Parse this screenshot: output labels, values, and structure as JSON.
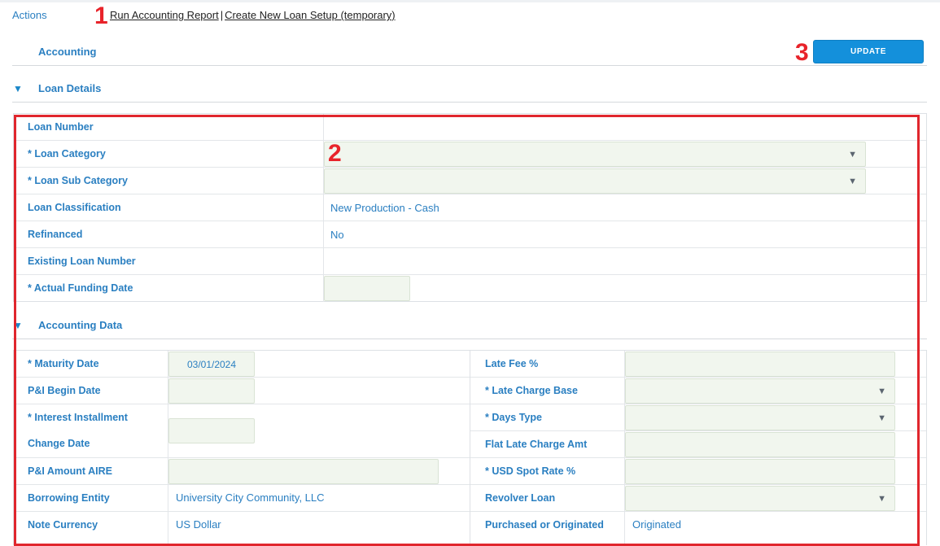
{
  "header": {
    "actions_label": "Actions",
    "links": [
      "Run Accounting Report",
      "Create New Loan Setup (temporary)"
    ],
    "separator": "|"
  },
  "markers": [
    "1",
    "2",
    "3"
  ],
  "accounting": {
    "title": "Accounting",
    "update_label": "UPDATE"
  },
  "loan_details": {
    "title": "Loan Details",
    "rows": [
      {
        "label": "Loan Number",
        "value": ""
      },
      {
        "label": "* Loan Category",
        "value": ""
      },
      {
        "label": "* Loan Sub Category",
        "value": ""
      },
      {
        "label": "Loan Classification",
        "value": "New Production - Cash"
      },
      {
        "label": "Refinanced",
        "value": "No"
      },
      {
        "label": "Existing Loan Number",
        "value": ""
      },
      {
        "label": "* Actual Funding Date",
        "value": ""
      }
    ]
  },
  "accounting_data": {
    "title": "Accounting Data",
    "left": [
      {
        "label": "* Maturity Date",
        "value": "03/01/2024"
      },
      {
        "label": "P&I Begin Date",
        "value": ""
      },
      {
        "label": "* Interest Installment",
        "label2": "Change Date",
        "value": ""
      },
      {
        "label": "P&I Amount AIRE",
        "value": ""
      },
      {
        "label": "Borrowing Entity",
        "value": "University City Community, LLC"
      },
      {
        "label": "Note Currency",
        "value": "US Dollar"
      }
    ],
    "right": [
      {
        "label": "Late Fee %",
        "value": ""
      },
      {
        "label": "* Late Charge Base",
        "value": ""
      },
      {
        "label": "* Days Type",
        "value": ""
      },
      {
        "label": "Flat Late Charge Amt",
        "value": ""
      },
      {
        "label": "* USD Spot Rate %",
        "value": ""
      },
      {
        "label": "Revolver Loan",
        "value": ""
      },
      {
        "label": "Purchased or Originated",
        "value": "Originated"
      }
    ]
  },
  "icons": {
    "collapse": "triangle-down-icon",
    "dropdown": "chevron-down-icon"
  },
  "glyphs": {
    "triangle": "▼",
    "caret": "▼"
  },
  "colors": {
    "accent": "#1490db",
    "label": "#2a7fc1",
    "highlight": "#e0262d",
    "field_bg": "#f1f6ee"
  }
}
